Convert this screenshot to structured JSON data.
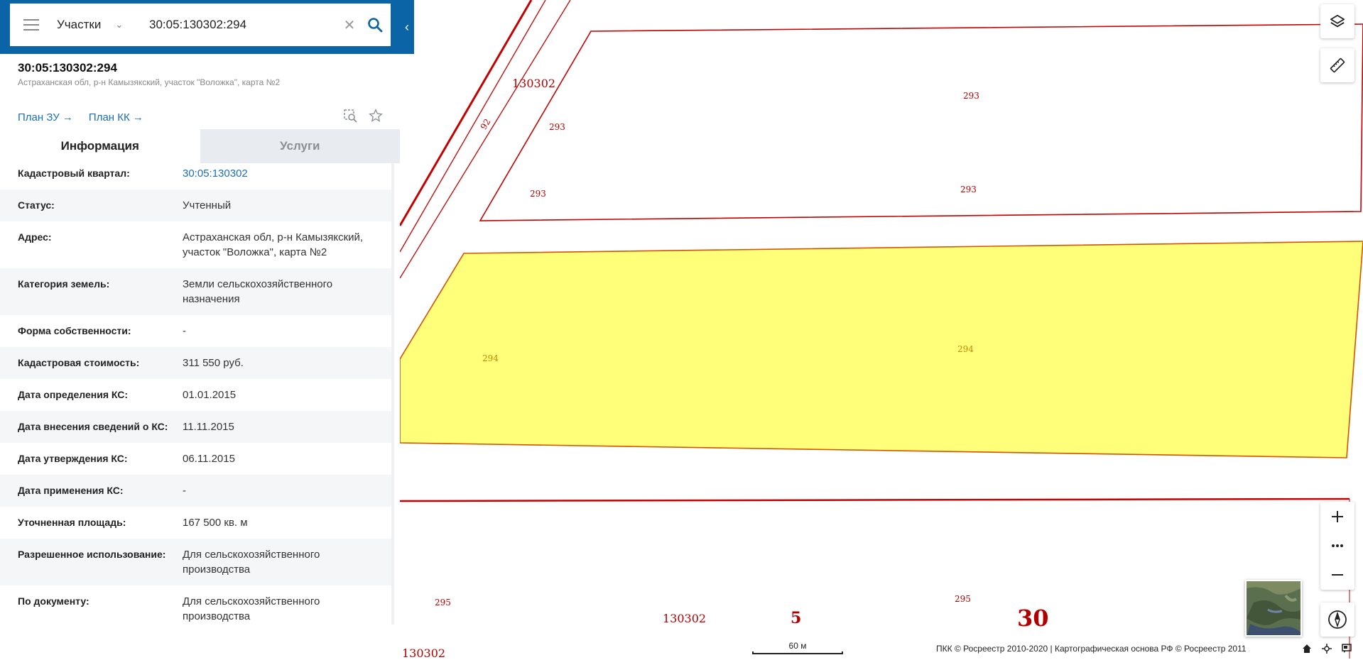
{
  "search": {
    "category": "Участки",
    "query": "30:05:130302:294"
  },
  "object": {
    "number": "30:05:130302:294",
    "address": "Астраханская обл, р-н Камызякский, участок \"Воложка\", карта №2",
    "links": [
      "План ЗУ",
      "План КК"
    ]
  },
  "tabs": [
    {
      "label": "Информация",
      "active": true
    },
    {
      "label": "Услуги",
      "active": false
    }
  ],
  "info": [
    {
      "key": "Кадастровый квартал:",
      "value": "30:05:130302",
      "link": true
    },
    {
      "key": "Статус:",
      "value": "Учтенный"
    },
    {
      "key": "Адрес:",
      "value": "Астраханская обл, р-н Камызякский, участок \"Воложка\", карта №2"
    },
    {
      "key": "Категория земель:",
      "value": "Земли сельскохозяйственного назначения"
    },
    {
      "key": "Форма собственности:",
      "value": "-"
    },
    {
      "key": "Кадастровая стоимость:",
      "value": "311 550 руб."
    },
    {
      "key": "Дата определения КС:",
      "value": "01.01.2015"
    },
    {
      "key": "Дата внесения сведений о КС:",
      "value": "11.11.2015"
    },
    {
      "key": "Дата утверждения КС:",
      "value": "06.11.2015"
    },
    {
      "key": "Дата применения КС:",
      "value": "-"
    },
    {
      "key": "Уточненная площадь:",
      "value": "167 500 кв. м"
    },
    {
      "key": "Разрешенное использование:",
      "value": "Для сельскохозяйственного производства"
    },
    {
      "key": "По документу:",
      "value": "Для сельскохозяйственного производства"
    }
  ],
  "map": {
    "labels": {
      "q1": "130302",
      "q2": "130302",
      "q3": "130302",
      "p92": "92",
      "p293a": "293",
      "p293b": "293",
      "p293c": "293",
      "p293d": "293",
      "p294a": "294",
      "p294b": "294",
      "p295a": "295",
      "p295b": "295",
      "d5": "5",
      "d30": "30"
    },
    "scale": "60 м",
    "copyright": "ПКК © Росреестр 2010-2020 | Картографическая основа РФ © Росреестр 2011",
    "colors": {
      "boundary": "#c40000",
      "selected_fill": "#ffff7a",
      "accent": "#0b64a6"
    }
  }
}
